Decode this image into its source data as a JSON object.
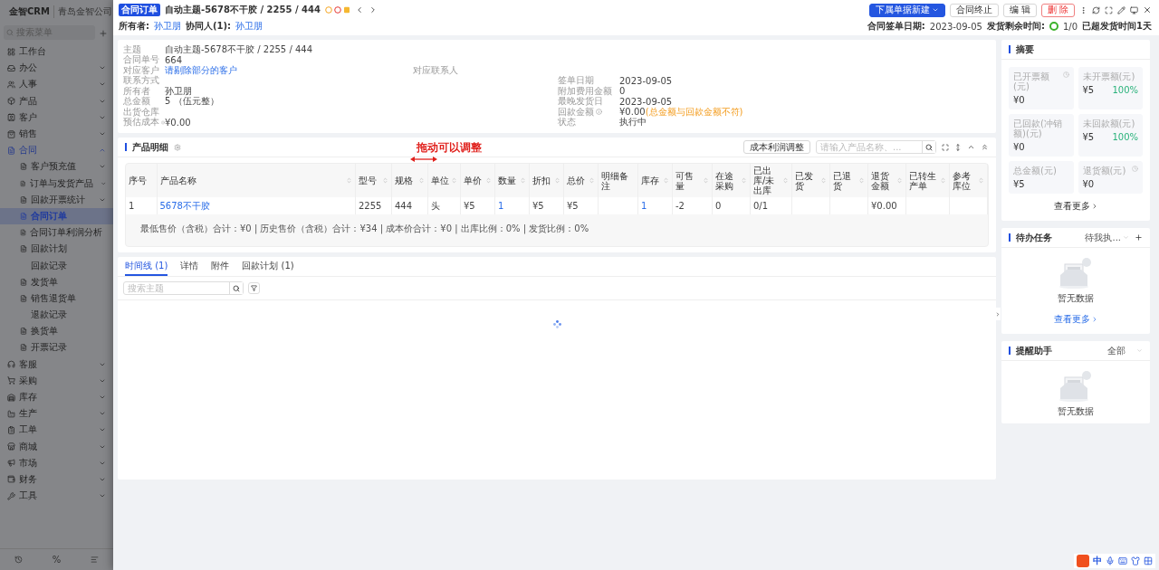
{
  "sidebar": {
    "brand": "金智CRM",
    "company": "青岛金智公司",
    "search_placeholder": "搜索菜单",
    "items": [
      {
        "label": "工作台",
        "kind": "page",
        "selected": false
      },
      {
        "label": "办公",
        "kind": "folder",
        "expanded": false,
        "selected": false
      },
      {
        "label": "人事",
        "kind": "folder",
        "expanded": false,
        "selected": false
      },
      {
        "label": "产品",
        "kind": "folder",
        "expanded": false,
        "selected": false
      },
      {
        "label": "客户",
        "kind": "folder",
        "expanded": false,
        "selected": false
      },
      {
        "label": "销售",
        "kind": "folder",
        "expanded": false,
        "selected": false
      },
      {
        "label": "合同",
        "kind": "folder",
        "expanded": true,
        "selected": false,
        "children": [
          {
            "label": "客户预充值",
            "kind": "folder",
            "expanded": false,
            "icon": true,
            "selected": false
          },
          {
            "label": "订单与发货产品",
            "kind": "folder",
            "expanded": false,
            "icon": true,
            "selected": false
          },
          {
            "label": "回款开票统计",
            "kind": "folder",
            "expanded": false,
            "icon": true,
            "selected": false
          },
          {
            "label": "合同订单",
            "kind": "page",
            "icon": true,
            "selected": true
          },
          {
            "label": "合同订单利润分析",
            "kind": "page",
            "icon": true,
            "selected": false
          },
          {
            "label": "回款计划",
            "kind": "page",
            "icon": true,
            "selected": false
          },
          {
            "label": "回款记录",
            "kind": "page",
            "icon": false,
            "selected": false
          },
          {
            "label": "发货单",
            "kind": "page",
            "icon": true,
            "selected": false
          },
          {
            "label": "销售退货单",
            "kind": "page",
            "icon": true,
            "selected": false
          },
          {
            "label": "退款记录",
            "kind": "page",
            "icon": false,
            "selected": false
          },
          {
            "label": "换货单",
            "kind": "page",
            "icon": true,
            "selected": false
          },
          {
            "label": "开票记录",
            "kind": "page",
            "icon": true,
            "selected": false
          }
        ]
      },
      {
        "label": "客服",
        "kind": "folder",
        "expanded": false,
        "selected": false
      },
      {
        "label": "采购",
        "kind": "folder",
        "expanded": false,
        "selected": false
      },
      {
        "label": "库存",
        "kind": "folder",
        "expanded": false,
        "selected": false
      },
      {
        "label": "生产",
        "kind": "folder",
        "expanded": false,
        "selected": false
      },
      {
        "label": "工单",
        "kind": "folder",
        "expanded": false,
        "selected": false
      },
      {
        "label": "商城",
        "kind": "folder",
        "expanded": false,
        "selected": false
      },
      {
        "label": "市场",
        "kind": "folder",
        "expanded": false,
        "selected": false
      },
      {
        "label": "财务",
        "kind": "folder",
        "expanded": false,
        "selected": false
      },
      {
        "label": "工具",
        "kind": "folder",
        "expanded": false,
        "selected": false
      }
    ],
    "footer_label": "%"
  },
  "header": {
    "badge": "合同订单",
    "title": "自动主题-5678不干胶 / 2255 / 444",
    "owner_label": "所有者:",
    "owner": "孙卫朋",
    "collaborator_label": "协同人(1):",
    "collaborator": "孙卫朋",
    "buttons": [
      {
        "label": "下属单据新建",
        "kind": "primary"
      },
      {
        "label": "合同终止",
        "kind": "default"
      },
      {
        "label": "编 辑",
        "kind": "default"
      },
      {
        "label": "删 除",
        "kind": "danger"
      }
    ],
    "sign_date_label": "合同签单日期:",
    "sign_date": "2023-09-05",
    "remaining_label": "发货剩余时间:",
    "progress": "1/0",
    "overdue": "已超发货时间1天"
  },
  "info_rows": [
    {
      "left": {
        "label": "主题",
        "value": "自动主题-5678不干胶 / 2255 / 444"
      }
    },
    {
      "left": {
        "label": "合同单号",
        "value": "664"
      }
    },
    {
      "left": {
        "label": "对应客户",
        "value": "请剔除部分的客户",
        "kind": "link"
      },
      "middle": {
        "label": "对应联系人"
      }
    },
    {
      "left": {
        "label": "联系方式"
      },
      "right": {
        "label": "签单日期",
        "value": "2023-09-05"
      }
    },
    {
      "left": {
        "label": "所有者",
        "value": "孙卫朋"
      },
      "right": {
        "label": "附加费用金额",
        "value": "0"
      }
    },
    {
      "left": {
        "label": "总金额",
        "value": "5 （伍元整）"
      },
      "right": {
        "label": "最晚发货日",
        "value": "2023-09-05"
      }
    },
    {
      "left": {
        "label": "出货仓库"
      },
      "right": {
        "label": "回款金额",
        "value": "¥0.00",
        "note": "(总金额与回款金额不符)",
        "info": true
      }
    },
    {
      "left": {
        "label": "预估成本",
        "value": "¥0.00",
        "info": true
      },
      "right": {
        "label": "状态",
        "value": "执行中"
      }
    }
  ],
  "products": {
    "title": "产品明细",
    "adjust_button": "成本利润调整",
    "search_placeholder": "请输入产品名称、...",
    "annotation": "拖动可以调整",
    "columns": [
      {
        "label": "序号",
        "sortable": false
      },
      {
        "label": "产品名称",
        "sortable": true
      },
      {
        "label": "型号",
        "sortable": true
      },
      {
        "label": "规格",
        "sortable": true
      },
      {
        "label": "单位",
        "sortable": true
      },
      {
        "label": "单价",
        "sortable": true
      },
      {
        "label": "数量",
        "sortable": true
      },
      {
        "label": "折扣",
        "sortable": true
      },
      {
        "label": "总价",
        "sortable": true
      },
      {
        "label": "明细备注",
        "sortable": false
      },
      {
        "label": "库存",
        "sortable": true
      },
      {
        "label": "可售量",
        "sortable": true
      },
      {
        "label": "在途采购",
        "sortable": true
      },
      {
        "label": "已出库/未出库",
        "sortable": true
      },
      {
        "label": "已发货",
        "sortable": true
      },
      {
        "label": "已退货",
        "sortable": true
      },
      {
        "label": "退货金额",
        "sortable": true
      },
      {
        "label": "已转生产单",
        "sortable": true
      },
      {
        "label": "参考库位",
        "sortable": true
      }
    ],
    "rows": [
      {
        "cells": [
          {
            "text": "1"
          },
          {
            "text": "5678不干胶",
            "kind": "link"
          },
          {
            "text": "2255"
          },
          {
            "text": "444"
          },
          {
            "text": "头"
          },
          {
            "text": "¥5"
          },
          {
            "text": "1",
            "kind": "link"
          },
          {
            "text": "¥5"
          },
          {
            "text": "¥5"
          },
          {
            "text": ""
          },
          {
            "text": "1",
            "kind": "link"
          },
          {
            "text": "-2"
          },
          {
            "text": "0"
          },
          {
            "text": "0/1"
          },
          {
            "text": ""
          },
          {
            "text": ""
          },
          {
            "text": "¥0.00"
          },
          {
            "text": ""
          },
          {
            "text": ""
          }
        ]
      }
    ],
    "summary": "最低售价（含税）合计：¥0 | 历史售价（含税）合计：¥34 | 成本价合计：¥0 | 出库比例：0% | 发货比例：0%"
  },
  "activity": {
    "tabs": [
      {
        "label": "时间线 (1)",
        "selected": true
      },
      {
        "label": "详情",
        "selected": false
      },
      {
        "label": "附件",
        "selected": false
      },
      {
        "label": "回款计划 (1)",
        "selected": false
      }
    ],
    "search_placeholder": "搜索主题"
  },
  "summary": {
    "title": "摘要",
    "stats": [
      {
        "label": "已开票额(元)",
        "value": "¥0",
        "info": true
      },
      {
        "label": "未开票额(元)",
        "value": "¥5",
        "percent": "100%"
      },
      {
        "label": "已回款(冲销额)(元)",
        "value": "¥0"
      },
      {
        "label": "未回款额(元)",
        "value": "¥5",
        "percent": "100%"
      },
      {
        "label": "总金额(元)",
        "value": "¥5"
      },
      {
        "label": "退货额(元)",
        "value": "¥0",
        "info": true
      }
    ],
    "more": "查看更多"
  },
  "tasks": {
    "title": "待办任务",
    "filter": "待我执...",
    "empty": "暂无数据",
    "more": "查看更多"
  },
  "reminders": {
    "title": "提醒助手",
    "filter": "全部",
    "empty": "暂无数据"
  },
  "ime": {
    "language": "中"
  }
}
